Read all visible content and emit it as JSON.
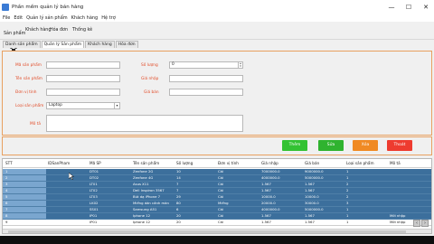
{
  "window": {
    "title": "Phần mềm quản lý bán hàng",
    "controls": {
      "minimize": "—",
      "maximize": "☐",
      "close": "✕"
    }
  },
  "menu": [
    "File",
    "Edit",
    "Quản lý sản phẩm",
    "Khách hàng",
    "Hệ trợ"
  ],
  "toolbar": {
    "product_label": "Sản phẩm",
    "links": [
      "Khách hàng",
      "Hóa đơn",
      "Thống kê"
    ]
  },
  "tabs": [
    "Danh sản phẩm",
    "Quản lý Sản phẩm",
    "Khách hàng",
    "Hóa đơn"
  ],
  "form": {
    "labels": {
      "product_code": "Mã sản phẩm",
      "product_name": "Tên sản phẩm",
      "unit": "Đơn vị tính",
      "category": "Loại sản phẩm",
      "description": "Mô tả",
      "quantity": "Số lượng",
      "import_price": "Giá nhập",
      "sale_price": "Giá bán"
    },
    "values": {
      "product_code": "",
      "product_name": "",
      "unit": "",
      "category": "Laptop",
      "description": "",
      "quantity": "0",
      "import_price": "",
      "sale_price": ""
    }
  },
  "buttons": {
    "add": "Thêm",
    "edit": "Sửa",
    "delete": "Xóa",
    "exit": "Thoát",
    "colors": {
      "add": "#33c233",
      "edit": "#2fb32f",
      "delete": "#f08a23",
      "exit": "#ee3b2f"
    }
  },
  "table": {
    "columns": [
      "STT",
      "IDSanPham",
      "Mã SP",
      "Tên sản phẩm",
      "Số lượng",
      "Đơn vị tính",
      "Giá nhập",
      "Giá bán",
      "Loại sản phẩm",
      "Mô tả"
    ],
    "rows": [
      [
        "1",
        "",
        "DT01",
        "Zenfone 2G",
        "10",
        "Cái",
        "7000000.0",
        "9000000.0",
        "1",
        ""
      ],
      [
        "2",
        "",
        "DT02",
        "Zenfone 4G",
        "14",
        "Cái",
        "4000000.0",
        "5000000.0",
        "1",
        ""
      ],
      [
        "3",
        "",
        "LT01",
        "Asus X11",
        "7",
        "Cái",
        "1.567",
        "1.567",
        "2",
        ""
      ],
      [
        "4",
        "",
        "LT02",
        "Dell Inspiron 3567",
        "7",
        "Cái",
        "1.567",
        "1.567",
        "2",
        ""
      ],
      [
        "5",
        "",
        "LT03",
        "Bút dạ iPhone 7",
        "29",
        "Cái",
        "10000.0",
        "10000.0",
        "2",
        ""
      ],
      [
        "6",
        "",
        "LK02",
        "Miếng dán cảnh màn",
        "80",
        "Miếng",
        "20000.0",
        "30000.0",
        "3",
        ""
      ],
      [
        "7",
        "",
        "SS01",
        "Samsung A51",
        "6",
        "Cái",
        "4000000.0",
        "5000000.0",
        "1",
        ""
      ],
      [
        "8",
        "",
        "IP01",
        "Iphone 12",
        "20",
        "Cái",
        "1.567",
        "1.567",
        "1",
        "Mới nhập"
      ]
    ],
    "last_row": [
      "9",
      "",
      "IP01",
      "Iphone 12",
      "20",
      "Cái",
      "1.567",
      "1.567",
      "1",
      "Mới nhập"
    ]
  }
}
